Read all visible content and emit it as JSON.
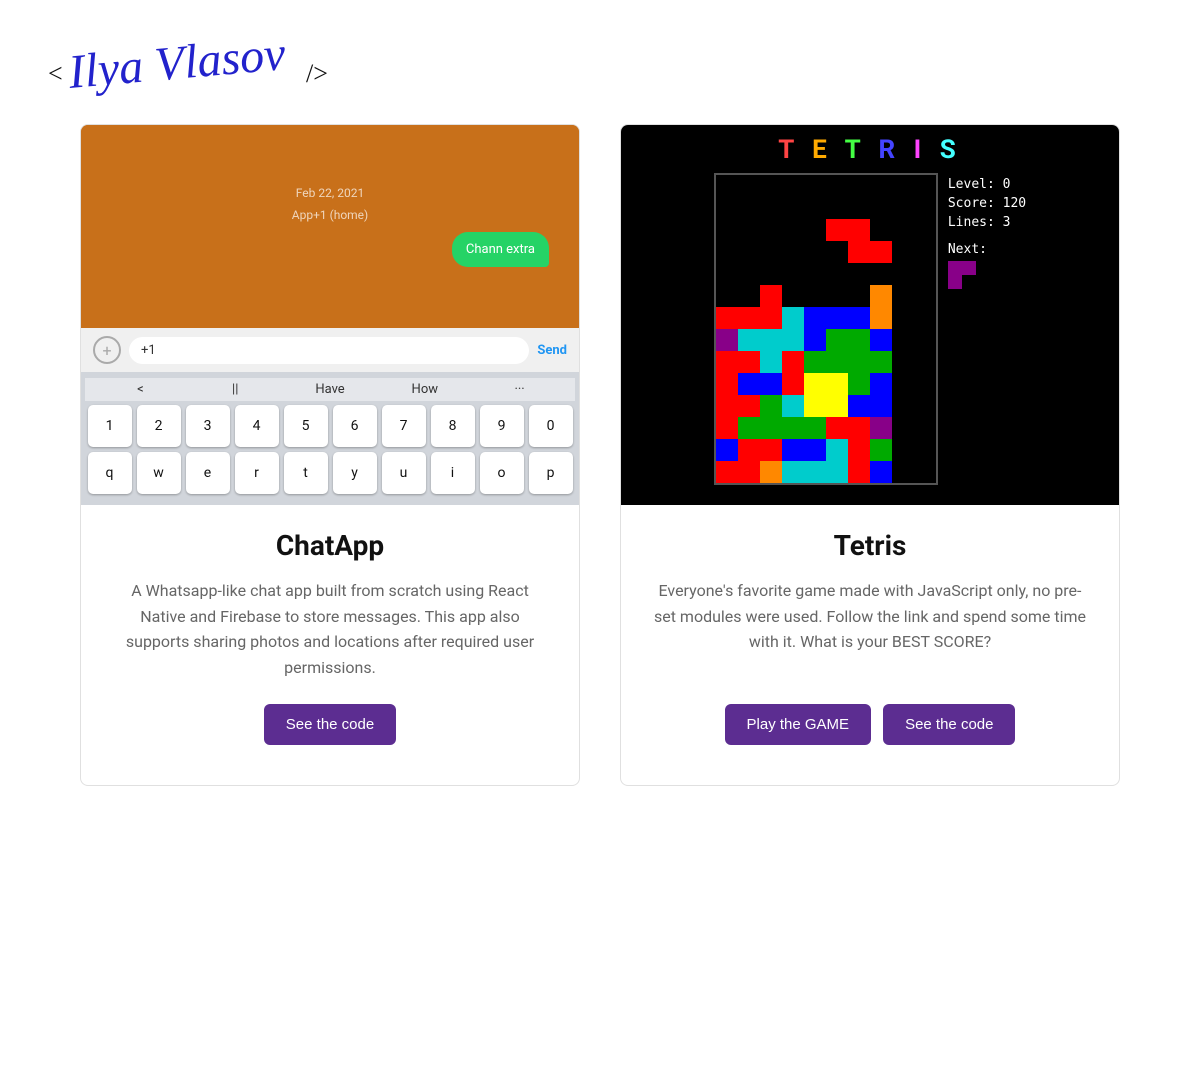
{
  "header": {
    "logo_text": "< Ilya Vlasov />",
    "logo_aria": "Ilya Vlasov logo"
  },
  "cards": [
    {
      "id": "chatapp",
      "title": "ChatApp",
      "description": "A Whatsapp-like chat app built from scratch using React Native and Firebase to store messages. This app also supports sharing photos and locations after required user permissions.",
      "buttons": [
        {
          "label": "See the code",
          "id": "chatapp-code-btn"
        }
      ],
      "screenshot": {
        "chat_date": "Feb 22, 2021",
        "chat_label": "App+1 (home)",
        "bubble_text": "Chann extra",
        "input_placeholder": "+1",
        "send_label": "Send",
        "suggestions": [
          "<",
          "||",
          "Have",
          "How",
          "..."
        ]
      }
    },
    {
      "id": "tetris",
      "title": "Tetris",
      "description": "Everyone's favorite game made with JavaScript only, no pre-set modules were used. Follow the link and spend some time with it. What is your BEST SCORE?",
      "buttons": [
        {
          "label": "Play the GAME",
          "id": "tetris-play-btn"
        },
        {
          "label": "See the code",
          "id": "tetris-code-btn"
        }
      ],
      "screenshot": {
        "title_letters": [
          "T",
          "E",
          "T",
          "R",
          "I",
          "S"
        ],
        "level": "0",
        "score": "120",
        "lines": "3"
      }
    }
  ]
}
